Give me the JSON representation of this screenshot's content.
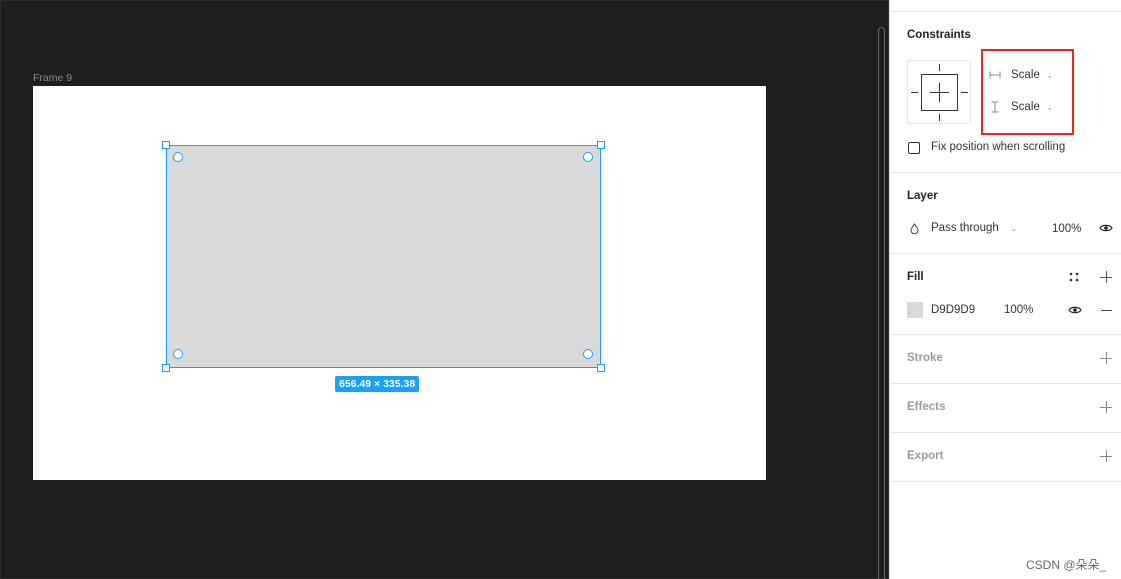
{
  "canvas": {
    "frame_label": "Frame 9",
    "size_badge": "656.49 × 335.38",
    "selection_color": "#18a0fb",
    "canvas_bg": "#1e1e1e",
    "rect_fill": "#d9d9d9"
  },
  "panel": {
    "constraints": {
      "title": "Constraints",
      "horizontal": {
        "icon": "horizontal-constraint-icon",
        "value": "Scale"
      },
      "vertical": {
        "icon": "vertical-constraint-icon",
        "value": "Scale"
      },
      "fix_position_label": "Fix position when scrolling",
      "fix_position_checked": false,
      "highlight_color": "#e8271d"
    },
    "layer": {
      "title": "Layer",
      "blend_mode": "Pass through",
      "opacity": "100%"
    },
    "fill": {
      "title": "Fill",
      "hex": "D9D9D9",
      "opacity": "100%",
      "swatch_color": "#d9d9d9"
    },
    "stroke": {
      "title": "Stroke"
    },
    "effects": {
      "title": "Effects"
    },
    "export": {
      "title": "Export"
    }
  },
  "watermark": "CSDN @朵朵_"
}
